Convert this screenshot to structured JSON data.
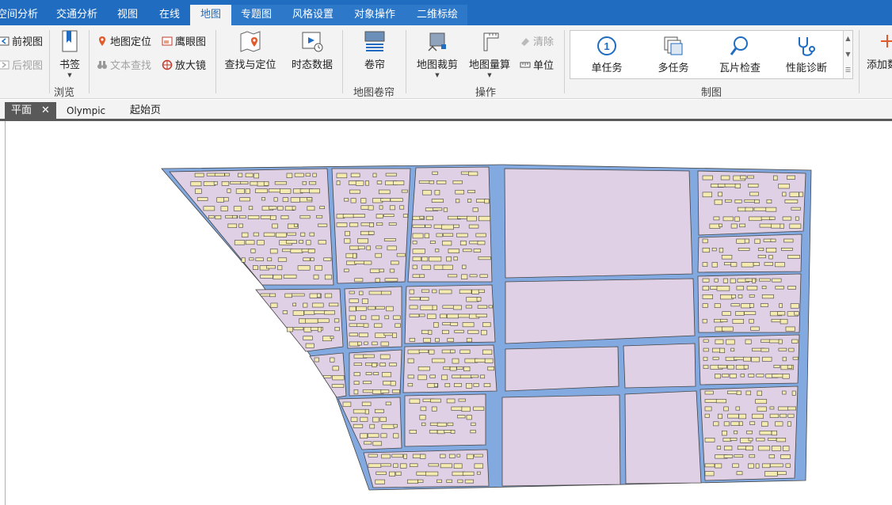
{
  "menu": {
    "tabs": [
      {
        "label": "空间分析",
        "active": false
      },
      {
        "label": "交通分析",
        "active": false
      },
      {
        "label": "视图",
        "active": false
      },
      {
        "label": "在线",
        "active": false
      },
      {
        "label": "地图",
        "active": true
      },
      {
        "label": "专题图",
        "active": false
      },
      {
        "label": "风格设置",
        "active": false
      },
      {
        "label": "对象操作",
        "active": false
      },
      {
        "label": "二维标绘",
        "active": false
      }
    ]
  },
  "ribbon": {
    "browse": {
      "prev_view": "前视图",
      "next_view": "后视图",
      "bookmark": "书签",
      "map_locate": "地图定位",
      "text_search": "文本查找",
      "eagle_eye": "鹰眼图",
      "magnifier": "放大镜",
      "find_locate": "查找与定位",
      "temporal_data": "时态数据",
      "group_label": "浏览"
    },
    "swipe": {
      "swipe": "卷帘",
      "group_label": "地图卷帘"
    },
    "ops": {
      "map_clip": "地图裁剪",
      "map_measure": "地图量算",
      "clear": "清除",
      "unit": "单位",
      "group_label": "操作"
    },
    "cartography": {
      "items": [
        "单任务",
        "多任务",
        "瓦片检查",
        "性能诊断"
      ],
      "group_label": "制图"
    },
    "add_data": "添加数"
  },
  "doc_tabs": {
    "tabs": [
      {
        "label": "平面",
        "active": true,
        "closable": true
      },
      {
        "label": "Olympic",
        "active": false
      },
      {
        "label": "起始页",
        "active": false
      }
    ]
  },
  "map": {
    "colors": {
      "road": "#82a9e0",
      "block": "#e0d0e5",
      "building": "#f5eaaf",
      "outline": "#444444"
    }
  }
}
